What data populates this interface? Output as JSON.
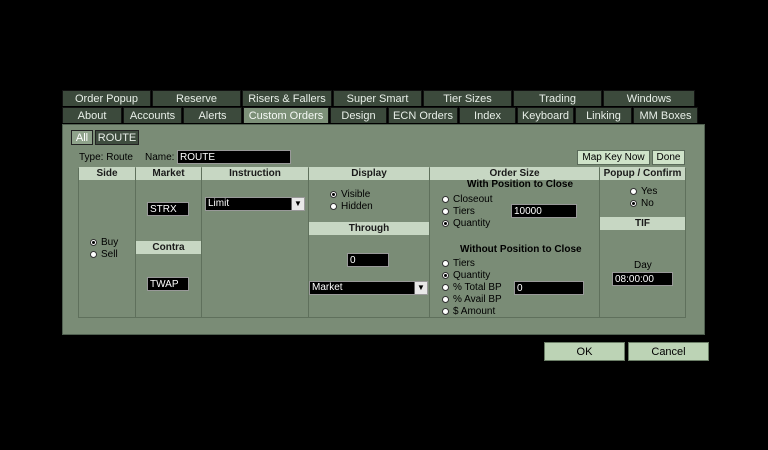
{
  "tabs_row1": [
    "Order Popup",
    "Reserve",
    "Risers & Fallers",
    "Super Smart",
    "Tier Sizes",
    "Trading",
    "Windows"
  ],
  "tabs_row2": [
    "About",
    "Accounts",
    "Alerts",
    "Custom Orders",
    "Design",
    "ECN Orders",
    "Index",
    "Keyboard",
    "Linking",
    "MM Boxes"
  ],
  "active_tab": "Custom Orders",
  "subtabs": {
    "all": "All",
    "route": "ROUTE"
  },
  "type_label": "Type: Route",
  "name_label": "Name:",
  "name_value": "ROUTE",
  "buttons": {
    "map_key_now": "Map Key Now",
    "done": "Done",
    "ok": "OK",
    "cancel": "Cancel"
  },
  "columns": {
    "side": "Side",
    "market": "Market",
    "contra": "Contra",
    "instruction": "Instruction",
    "display": "Display",
    "through": "Through",
    "order_size": "Order Size",
    "popup_confirm": "Popup / Confirm",
    "tif": "TIF"
  },
  "side_options": [
    {
      "label": "Buy",
      "selected": true
    },
    {
      "label": "Sell",
      "selected": false
    }
  ],
  "market_value": "STRX",
  "contra_value": "TWAP",
  "instruction_value": "Limit",
  "display_options": [
    {
      "label": "Visible",
      "selected": true
    },
    {
      "label": "Hidden",
      "selected": false
    }
  ],
  "through_value": "0",
  "through_select": "Market",
  "with_position_title": "With Position to Close",
  "with_position_options": [
    {
      "label": "Closeout",
      "selected": false
    },
    {
      "label": "Tiers",
      "selected": false
    },
    {
      "label": "Quantity",
      "selected": true
    }
  ],
  "with_position_value": "10000",
  "without_position_title": "Without Position to Close",
  "without_position_options": [
    {
      "label": "Tiers",
      "selected": false
    },
    {
      "label": "Quantity",
      "selected": true
    },
    {
      "label": "% Total BP",
      "selected": false
    },
    {
      "label": "% Avail BP",
      "selected": false
    },
    {
      "label": "$ Amount",
      "selected": false
    }
  ],
  "without_position_value": "0",
  "popup_options": [
    {
      "label": "Yes",
      "selected": false
    },
    {
      "label": "No",
      "selected": true
    }
  ],
  "tif_label": "Day",
  "tif_value": "08:00:00"
}
